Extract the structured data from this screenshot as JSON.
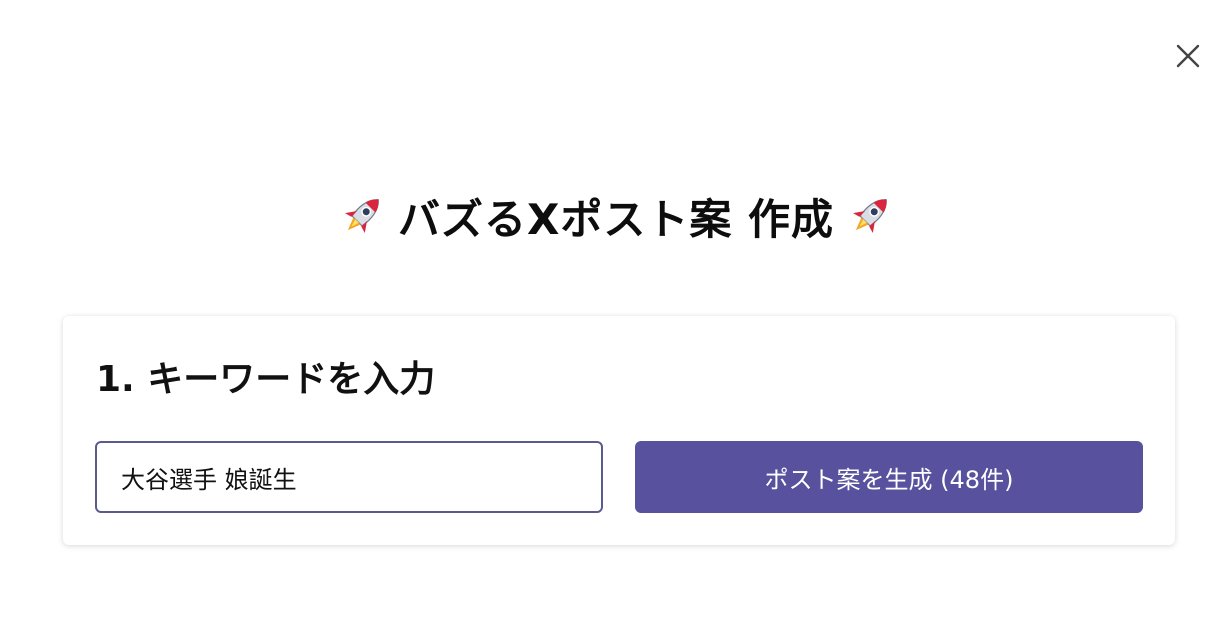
{
  "dialog": {
    "close_icon": "close-icon"
  },
  "header": {
    "title": "バズるXポスト案 作成",
    "left_icon": "rocket-icon",
    "right_icon": "rocket-icon"
  },
  "keyword_section": {
    "heading": "1. キーワードを入力",
    "input_value": "大谷選手 娘誕生",
    "generate_button_label": "ポスト案を生成 (48件)"
  },
  "colors": {
    "accent": "#58519e",
    "input_border": "#5a5a8e",
    "text": "#111111"
  }
}
